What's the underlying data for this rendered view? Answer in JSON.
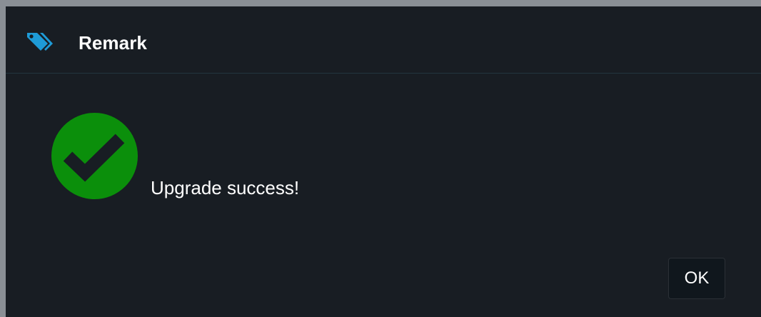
{
  "dialog": {
    "title": "Remark",
    "title_icon": "tag-icon",
    "status_icon": "success-check-icon",
    "message": "Upgrade success!",
    "ok_label": "OK"
  },
  "colors": {
    "background": "#181d23",
    "accent": "#1e9bd7",
    "success": "#0b8f0b",
    "text": "#ffffff"
  }
}
